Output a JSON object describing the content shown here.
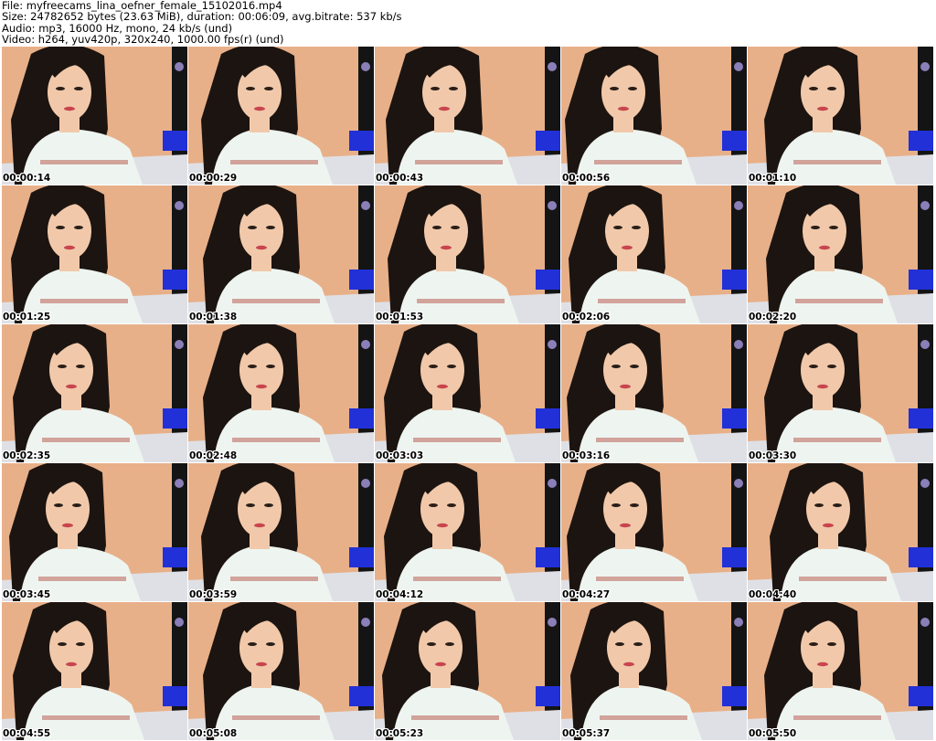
{
  "header": {
    "file": "File: myfreecams_lina_oefner_female_15102016.mp4",
    "size": "Size: 24782652 bytes (23.63 MiB), duration: 00:06:09, avg.bitrate: 537 kb/s",
    "audio": "Audio: mp3, 16000 Hz, mono, 24 kb/s (und)",
    "video": "Video: h264, yuv420p, 320x240, 1000.00 fps(r) (und)"
  },
  "thumbnails": [
    {
      "timestamp": "00:00:14"
    },
    {
      "timestamp": "00:00:29"
    },
    {
      "timestamp": "00:00:43"
    },
    {
      "timestamp": "00:00:56"
    },
    {
      "timestamp": "00:01:10"
    },
    {
      "timestamp": "00:01:25"
    },
    {
      "timestamp": "00:01:38"
    },
    {
      "timestamp": "00:01:53"
    },
    {
      "timestamp": "00:02:06"
    },
    {
      "timestamp": "00:02:20"
    },
    {
      "timestamp": "00:02:35"
    },
    {
      "timestamp": "00:02:48"
    },
    {
      "timestamp": "00:03:03"
    },
    {
      "timestamp": "00:03:16"
    },
    {
      "timestamp": "00:03:30"
    },
    {
      "timestamp": "00:03:45"
    },
    {
      "timestamp": "00:03:59"
    },
    {
      "timestamp": "00:04:12"
    },
    {
      "timestamp": "00:04:27"
    },
    {
      "timestamp": "00:04:40"
    },
    {
      "timestamp": "00:04:55"
    },
    {
      "timestamp": "00:05:08"
    },
    {
      "timestamp": "00:05:23"
    },
    {
      "timestamp": "00:05:37"
    },
    {
      "timestamp": "00:05:50"
    }
  ],
  "colors": {
    "wall": "#e8b089",
    "hair": "#1c1410",
    "skin": "#f1c9aa",
    "sweater": "#eef5f1",
    "stripe": "#c98f86",
    "lips": "#c8454f",
    "blanket": "#dfe0e6",
    "blue": "#2230d8",
    "dark": "#141414"
  }
}
